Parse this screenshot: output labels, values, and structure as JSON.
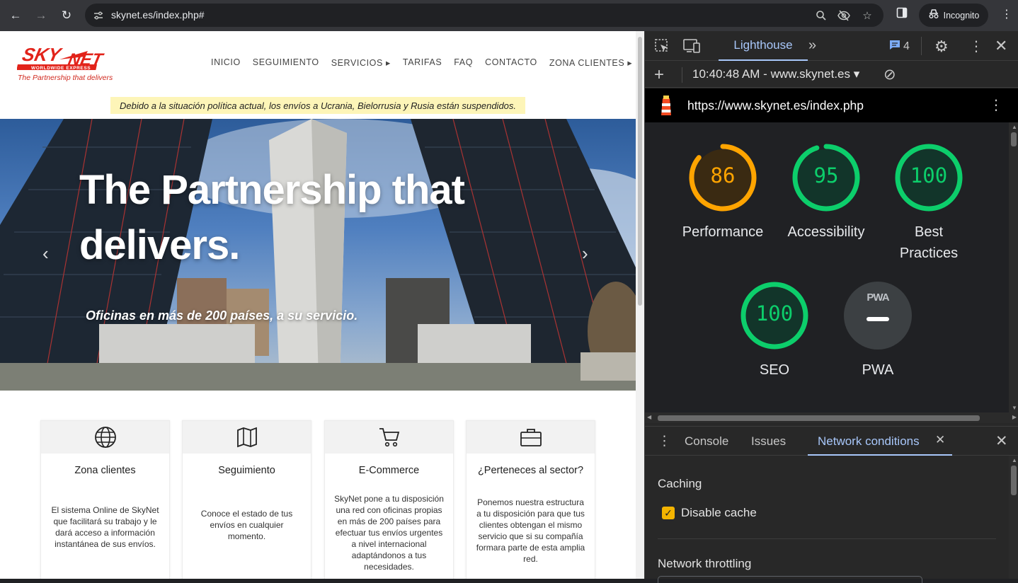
{
  "browser": {
    "url": "skynet.es/index.php#",
    "profile_label": "Incognito"
  },
  "site": {
    "logo": {
      "brand": "SKYNET",
      "tagline_small": "WORLDWIDE EXPRESS",
      "slogan": "The Partnership that delivers"
    },
    "nav": [
      "INICIO",
      "SEGUIMIENTO",
      "SERVICIOS ▸",
      "TARIFAS",
      "FAQ",
      "CONTACTO",
      "ZONA CLIENTES ▸"
    ],
    "notice": "Debido a la situación política actual, los envíos a Ucrania, Bielorrusia y Rusia están suspendidos.",
    "hero": {
      "title_line1": "The Partnership that",
      "title_line2": "delivers.",
      "subtitle": "Oficinas en más de 200 países, a su servicio."
    },
    "cards": [
      {
        "icon": "globe-icon",
        "title": "Zona clientes",
        "text": "El sistema Online de SkyNet que facilitará su trabajo y le dará acceso a información instantánea de sus envíos."
      },
      {
        "icon": "map-icon",
        "title": "Seguimiento",
        "text": "Conoce el estado de tus envíos en cualquier momento."
      },
      {
        "icon": "cart-icon",
        "title": "E-Commerce",
        "text": "SkyNet pone a tu disposición una red con oficinas propias en más de 200 países para efectuar tus envíos urgentes a nivel internacional adaptándonos a tus necesidades."
      },
      {
        "icon": "briefcase-icon",
        "title": "¿Perteneces al sector?",
        "text": "Ponemos nuestra estructura a tu disposición para que tus clientes obtengan el mismo servicio que si su compañía formara parte de esta amplia red."
      }
    ]
  },
  "devtools": {
    "active_tab": "Lighthouse",
    "issues_count": "4",
    "report_selector": "10:40:48 AM - www.skynet.es ▾",
    "report_url": "https://www.skynet.es/index.php",
    "scores": [
      {
        "label": "Performance",
        "value": 86,
        "display": "86",
        "color": "#ffa400"
      },
      {
        "label": "Accessibility",
        "value": 95,
        "display": "95",
        "color": "#0cce6b"
      },
      {
        "label": "Best Practices",
        "value": 100,
        "display": "100",
        "color": "#0cce6b"
      },
      {
        "label": "SEO",
        "value": 100,
        "display": "100",
        "color": "#0cce6b"
      },
      {
        "label": "PWA",
        "display": "PWA",
        "color": "#9aa0a6"
      }
    ],
    "drawer_tabs": [
      "Console",
      "Issues",
      "Network conditions"
    ],
    "network_conditions": {
      "caching_title": "Caching",
      "disable_cache_label": "Disable cache",
      "disable_cache_checked": true,
      "throttling_title": "Network throttling"
    }
  }
}
